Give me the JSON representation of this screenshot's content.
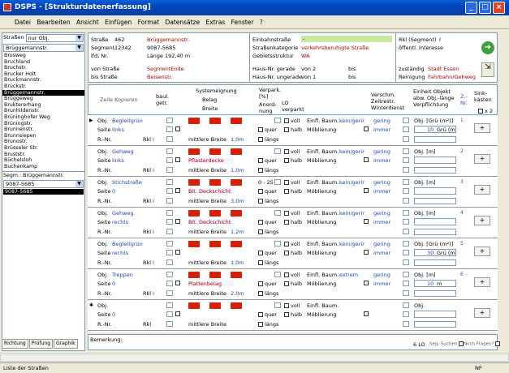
{
  "window": {
    "title": "DSPS - [Strukturdatenerfassung]"
  },
  "menu": [
    "Datei",
    "Bearbeiten",
    "Ansicht",
    "Einfügen",
    "Format",
    "Datensätze",
    "Extras",
    "Fenster",
    "?"
  ],
  "left": {
    "filter_label": "Straßen",
    "filter_value": "nur Obj.",
    "street_value": "Brüggemannstr.",
    "streets": [
      "Brosweg",
      "Bruchland",
      "Bruchstr.",
      "Brucker Holt",
      "Bruckmannstr.",
      "Brückstr.",
      "Brüggemannstr.",
      "Brüggeweg",
      "Brukterer­hang",
      "Brunhildenstr.",
      "Brüninghofer Weg",
      "Brüningstr.",
      "Brunnenstr.",
      "Brunnsiepen",
      "Brunostr.",
      "Brüsseler Str.",
      "Bruststr.",
      "Büchelsloh",
      "Buchenkamp"
    ],
    "selected_street": "Brüggemannstr.",
    "segm_label": "Segm.: Brüggemannstr.",
    "segm_value": "9087-5685",
    "segm_selected": "9087-5685",
    "tabs": [
      "Richtung",
      "Prüfung",
      "Graphik"
    ]
  },
  "header": {
    "strasse_label": "Straße",
    "strasse_nr": "462",
    "strasse_name": "Brüggemannstr.",
    "segment_label": "Segment",
    "segment_nr": "12342",
    "segment_code": "9087-5685",
    "lfd_label": "lfd. Nr.",
    "laenge_label": "Länge",
    "laenge_value": "192,40 m",
    "von_label": "von Straße",
    "von_value": "SegmentEnde",
    "bis_label": "bis Straße",
    "bis_value": "Beisenstr.",
    "einbahn_label": "Einbahnstraße",
    "einbahn_value": "-",
    "kategorie_label": "Straßenkategorie",
    "kategorie_value": "verkehrsberuhigte Straße",
    "gebiet_label": "Gebietsstruktur",
    "gebiet_value": "WA",
    "hausg_label": "Haus-Nr. gerade",
    "hausg_von": "von 2",
    "hausg_bis": "bis",
    "hausu_label": "Haus-Nr. ungerade",
    "hausu_von": "von 1",
    "hausu_bis": "bis",
    "rk_label": "Rkl (Segment)",
    "rk_value": "I",
    "interesse": "öffentl. Interesse",
    "zustaendig_label": "zuständig",
    "zustaendig_value": "Stadt Essen",
    "reinigung_label": "Reinigung",
    "reinigung_value": "Fahrbahn/Gehweg"
  },
  "columns": {
    "zeile": "Zeile Kopieren",
    "baul": "baul. getr.",
    "systemeignung": "Systemeignung",
    "belag": "Belag",
    "breite": "Breite",
    "verpark": "Verpark. [%]",
    "anord": "Anord-nung",
    "lo": "LO verparkt",
    "verschm": "Verschm. Zeitrestr. Winterdienst",
    "einheit": "Einheit Objekt abw. Obj.-länge Verpflichtung",
    "znr": "Z.-Nr.",
    "sink": "Sink-kästen",
    "x2": "x 2"
  },
  "rows": [
    {
      "obj": "Begleitgrün",
      "seite": "links",
      "rkl": "I",
      "belag": "",
      "breite": "mittlere Breite",
      "breite_val": "1,0m",
      "verpark": "",
      "einfl": "Einfl. Baum.",
      "einfl_val": "kein/gerir",
      "moebl": "Möblierung",
      "verschm": "gering",
      "zeit": "immer",
      "einheit": "Obj. [Grü (m²)]",
      "einheit_val": "10",
      "einheit_unit": "Grü (m",
      "znr": "1",
      "vis_quer": "quer",
      "vis_laengs": "längs",
      "vis_voll": "voll",
      "vis_halb": "halb"
    },
    {
      "obj": "Gehweg",
      "seite": "links",
      "rkl": "I",
      "belag": "Pflasterdecke",
      "breite": "mittlere Breite",
      "breite_val": "1,0m",
      "verpark": "",
      "einfl": "Einfl. Baum.",
      "einfl_val": "kein/gerir",
      "moebl": "Möblierung",
      "verschm": "gering",
      "zeit": "immer",
      "einheit": "Obj. [m]",
      "einheit_val": "",
      "einheit_unit": "",
      "znr": "2",
      "vis_quer": "quer",
      "vis_laengs": "längs",
      "vis_voll": "voll",
      "vis_halb": "halb"
    },
    {
      "obj": "Stichstraße",
      "seite": "0",
      "rkl": "I",
      "belag": "Bit. Deckschicht",
      "breite": "mittlere Breite",
      "breite_val": "3,0m",
      "verpark": "0 - 25",
      "einfl": "Einfl. Baum.",
      "einfl_val": "kein/gerir",
      "moebl": "Möblierung",
      "verschm": "gering",
      "zeit": "immer",
      "einheit": "Obj. [m]",
      "einheit_val": "",
      "einheit_unit": "",
      "znr": "3",
      "vis_quer": "quer",
      "vis_laengs": "längs",
      "vis_voll": "voll",
      "vis_halb": "halb"
    },
    {
      "obj": "Gehweg",
      "seite": "rechts",
      "rkl": "I",
      "belag": "Bit. Deckschicht",
      "breite": "mittlere Breite",
      "breite_val": "1,2m",
      "verpark": "",
      "einfl": "Einfl. Baum.",
      "einfl_val": "kein/gerir",
      "moebl": "Möblierung",
      "verschm": "gering",
      "zeit": "immer",
      "einheit": "Obj. [m]",
      "einheit_val": "",
      "einheit_unit": "",
      "znr": "4",
      "vis_quer": "quer",
      "vis_laengs": "längs",
      "vis_voll": "voll",
      "vis_halb": "halb"
    },
    {
      "obj": "Begleitgrün",
      "seite": "rechts",
      "rkl": "I",
      "belag": "",
      "breite": "mittlere Breite",
      "breite_val": "1,0m",
      "verpark": "",
      "einfl": "Einfl. Baum.",
      "einfl_val": "kein/gerir",
      "moebl": "Möblierung",
      "verschm": "gering",
      "zeit": "immer",
      "einheit": "Obj. [Grü (m²)]",
      "einheit_val": "30",
      "einheit_unit": "Grü (m",
      "znr": "5",
      "vis_quer": "quer",
      "vis_laengs": "längs",
      "vis_voll": "voll",
      "vis_halb": "halb"
    },
    {
      "obj": "Treppen",
      "seite": "0",
      "rkl": "I",
      "belag": "Plattenbelag",
      "breite": "mittlere Breite",
      "breite_val": "2,0m",
      "verpark": "",
      "einfl": "Einfl. Baum.",
      "einfl_val": "extrem",
      "moebl": "Möblierung",
      "verschm": "gering",
      "zeit": "immer",
      "einheit": "Obj. [m]",
      "einheit_val": "10",
      "einheit_unit": "m",
      "znr": "6",
      "vis_quer": "quer",
      "vis_laengs": "längs",
      "vis_voll": "voll",
      "vis_halb": "halb"
    },
    {
      "obj": "",
      "seite": "0",
      "rkl": "",
      "belag": "",
      "breite": "mittlere Breite",
      "breite_val": "",
      "verpark": "",
      "einfl": "Einfl. Baum.",
      "einfl_val": "",
      "moebl": "Möblierung",
      "verschm": "",
      "zeit": "",
      "einheit": "Obj.",
      "einheit_val": "",
      "einheit_unit": "",
      "znr": "",
      "vis_quer": "quer",
      "vis_laengs": "längs",
      "vis_voll": "voll",
      "vis_halb": "halb"
    }
  ],
  "row_labels": {
    "obj": "Obj.",
    "seite": "Seite",
    "rnr": "R.-Nr.",
    "rkl": "Rkl"
  },
  "footer": {
    "bemerkung": "Bemerkung:",
    "lo": "6 LO",
    "seg_suchen": "Seg. Suchen",
    "noch_fragen": "Noch Fragen?",
    "status": "Liste der Straßen",
    "nf": "NF"
  }
}
